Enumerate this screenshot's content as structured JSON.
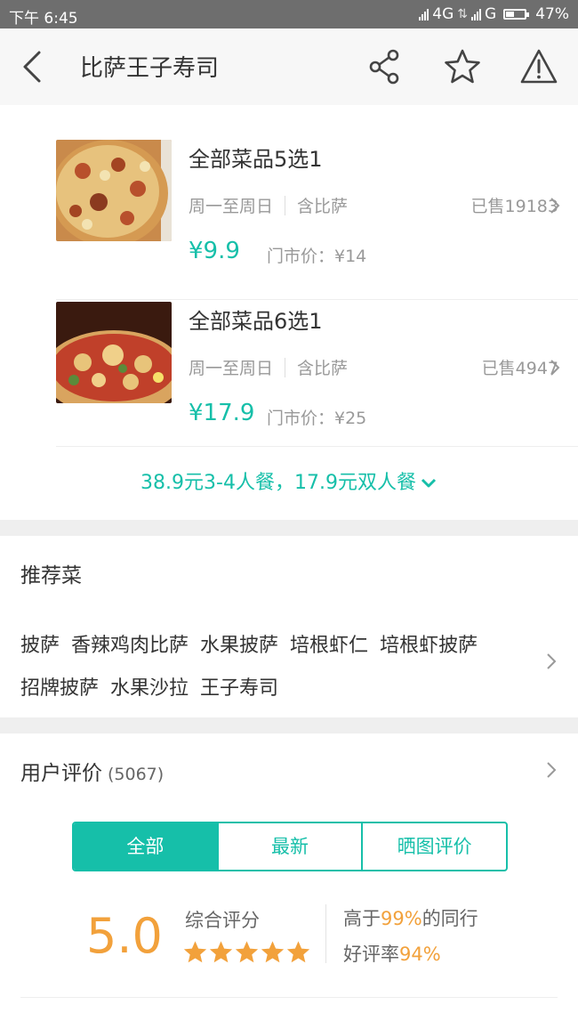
{
  "status_bar": {
    "time": "下午 6:45",
    "network1": "4G",
    "network2": "G",
    "battery": "47%",
    "battery_level": 0.47
  },
  "nav": {
    "title": "比萨王子寿司",
    "back_icon": "back-arrow-icon",
    "share_icon": "share-icon",
    "favorite_icon": "star-icon",
    "report_icon": "warning-icon"
  },
  "deals": [
    {
      "title": "全部菜品5选1",
      "days": "周一至周日",
      "tag": "含比萨",
      "sold": "已售19183",
      "price": "¥9.9",
      "orig": "门市价：¥14"
    },
    {
      "title": "全部菜品6选1",
      "days": "周一至周日",
      "tag": "含比萨",
      "sold": "已售4947",
      "price": "¥17.9",
      "orig": "门市价：¥25"
    }
  ],
  "more_deals": "38.9元3-4人餐，17.9元双人餐",
  "recommend": {
    "title": "推荐菜",
    "dishes": [
      "披萨",
      "香辣鸡肉比萨",
      "水果披萨",
      "培根虾仁",
      "培根虾披萨",
      "招牌披萨",
      "水果沙拉",
      "王子寿司"
    ]
  },
  "reviews": {
    "title": "用户评价",
    "count": "(5067)",
    "tabs": [
      "全部",
      "最新",
      "晒图评价"
    ],
    "active_tab": 0,
    "score": "5.0",
    "score_label": "综合评分",
    "stars": 5,
    "beat_prefix": "高于",
    "beat_value": "99%",
    "beat_suffix": "的同行",
    "good_prefix": "好评率",
    "good_value": "94%"
  },
  "colors": {
    "accent": "#16bfa9",
    "score": "#f2a13b",
    "statusbar": "#6e6e6e"
  }
}
